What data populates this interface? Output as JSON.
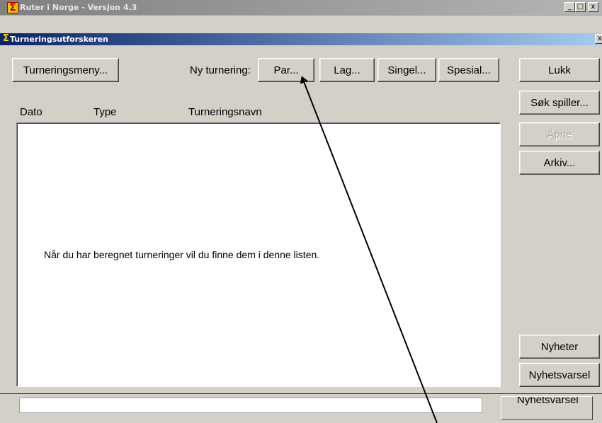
{
  "outer_window": {
    "title": "Ruter i Norge - Versjon 4.3",
    "icon": "sigma-app-icon",
    "caption_buttons": {
      "minimize": "_",
      "maximize": "□",
      "close": "x"
    }
  },
  "dialog": {
    "title": "Turneringsutforskeren",
    "icon": "sigma-app-icon",
    "close_glyph": "x"
  },
  "toolbar": {
    "tournament_menu": "Turneringsmeny...",
    "new_tournament_label": "Ny turnering:",
    "pair": "Par...",
    "team": "Lag...",
    "single": "Singel...",
    "special": "Spesial..."
  },
  "list": {
    "columns": [
      "Dato",
      "Type",
      "Turneringsnavn"
    ],
    "empty_message": "Når du har beregnet turneringer vil du finne dem i denne listen."
  },
  "side_buttons": {
    "close": "Lukk",
    "search_player": "Søk spiller...",
    "open": "Åpne",
    "archive": "Arkiv...",
    "news": "Nyheter",
    "news_alert": "Nyhetsvarsel"
  },
  "background_window": {
    "button_partial": "Nyhetsvarsel"
  },
  "colors": {
    "dialog_face": "#d4d0c8",
    "active_title_start": "#0a246a",
    "active_title_end": "#a6caf0",
    "annotation_arrow": "#000000"
  }
}
